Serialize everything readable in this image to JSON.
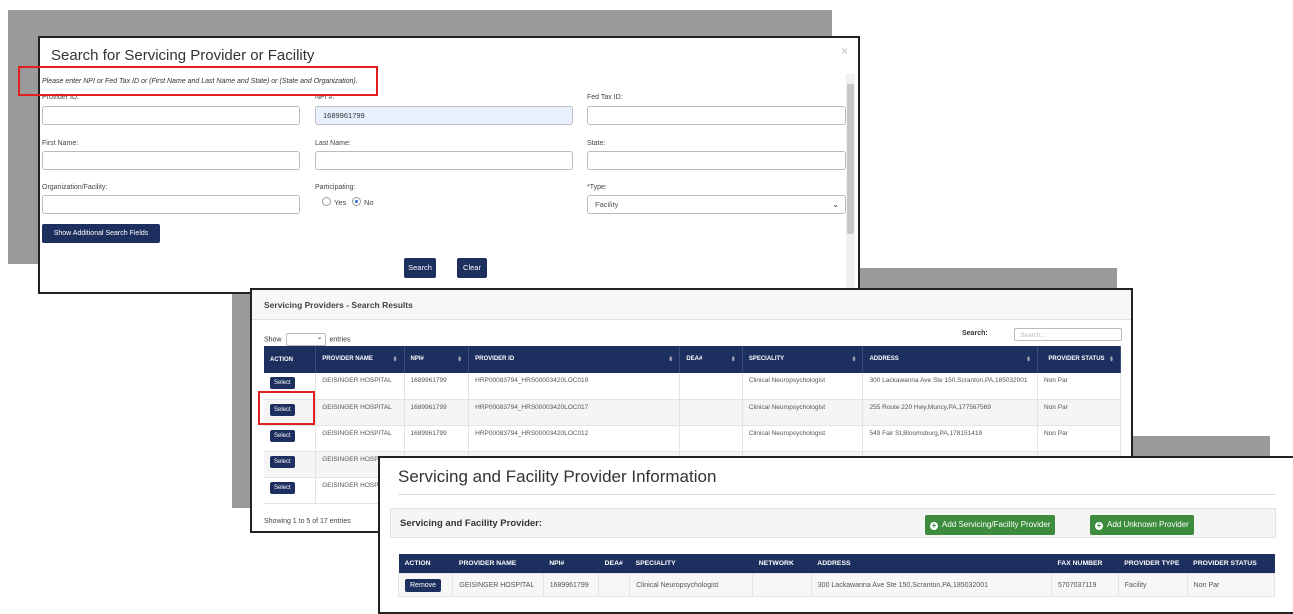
{
  "search_modal": {
    "title": "Search for Servicing Provider or Facility",
    "close_glyph": "×",
    "instruction": "Please enter NPI or Fed Tax ID or (First Name and Last Name and State) or (State and Organization).",
    "fields": {
      "provider_id": {
        "label": "Provider ID:",
        "value": ""
      },
      "npi": {
        "label": "NPI #:",
        "value": "1689961799"
      },
      "fed_tax_id": {
        "label": "Fed Tax ID:",
        "value": ""
      },
      "first_name": {
        "label": "First Name:",
        "value": ""
      },
      "last_name": {
        "label": "Last Name:",
        "value": ""
      },
      "state": {
        "label": "State:",
        "value": ""
      },
      "organization": {
        "label": "Organization/Facility:",
        "value": ""
      },
      "participating": {
        "label": "Participating:",
        "options": [
          "Yes",
          "No"
        ],
        "selected": "No"
      },
      "type": {
        "label": "*Type:",
        "value": "Facility"
      }
    },
    "show_additional_label": "Show Additional Search Fields",
    "search_label": "Search",
    "clear_label": "Clear"
  },
  "results": {
    "title": "Servicing Providers - Search Results",
    "show_label": "Show",
    "entries_label": "entries",
    "search_label": "Search:",
    "search_placeholder": "Search...",
    "columns": [
      "ACTION",
      "PROVIDER NAME",
      "NPI#",
      "PROVIDER ID",
      "DEA#",
      "SPECIALITY",
      "ADDRESS",
      "PROVIDER STATUS"
    ],
    "rows": [
      {
        "action": "Select",
        "name": "GEISINGER HOSPITAL",
        "npi": "1689961799",
        "provider_id": "HRP00083794_HRS00003420LOC019",
        "dea": "",
        "speciality": "Clinical Neuropsychologist",
        "address": "300 Lackawanna Ave Ste 150,Scranton,PA,185032001",
        "status": "Non Par"
      },
      {
        "action": "Select",
        "name": "GEISINGER HOSPITAL",
        "npi": "1689961799",
        "provider_id": "HRP00083794_HRS00003420LOC017",
        "dea": "",
        "speciality": "Clinical Neuropsychologist",
        "address": "255 Route 220 Hwy,Muncy,PA,177567569",
        "status": "Non Par"
      },
      {
        "action": "Select",
        "name": "GEISINGER HOSPITAL",
        "npi": "1689961799",
        "provider_id": "HRP00083794_HRS00003420LOC012",
        "dea": "",
        "speciality": "Clinical Neuropsychologist",
        "address": "549 Fair St,Bloomsburg,PA,178151419",
        "status": "Non Par"
      },
      {
        "action": "Select",
        "name": "GEISINGER HOSPITAL",
        "npi": "",
        "provider_id": "",
        "dea": "",
        "speciality": "",
        "address": "",
        "status": ""
      },
      {
        "action": "Select",
        "name": "GEISINGER HOSPITAL",
        "npi": "",
        "provider_id": "",
        "dea": "",
        "speciality": "",
        "address": "",
        "status": ""
      }
    ],
    "footer": "Showing 1 to 5 of 17 entries"
  },
  "provider_info": {
    "title": "Servicing and Facility Provider Information",
    "section_title": "Servicing and Facility Provider:",
    "add_servicing_label": "Add Servicing/Facility Provider",
    "add_unknown_label": "Add Unknown Provider",
    "columns": [
      "ACTION",
      "PROVIDER NAME",
      "NPI#",
      "DEA#",
      "SPECIALITY",
      "NETWORK",
      "ADDRESS",
      "FAX NUMBER",
      "PROVIDER TYPE",
      "PROVIDER STATUS"
    ],
    "rows": [
      {
        "action": "Remove",
        "name": "GEISINGER HOSPITAL",
        "npi": "1689961799",
        "dea": "",
        "speciality": "Clinical Neuropsychologist",
        "network": "",
        "address": "300 Lackawanna Ave Ste 150,Scranton,PA,185032001",
        "fax": "5707037119",
        "type": "Facility",
        "status": "Non Par"
      }
    ]
  },
  "colors": {
    "navy": "#1d2f5e",
    "green": "#3d8b3d",
    "highlight": "#e02020"
  }
}
